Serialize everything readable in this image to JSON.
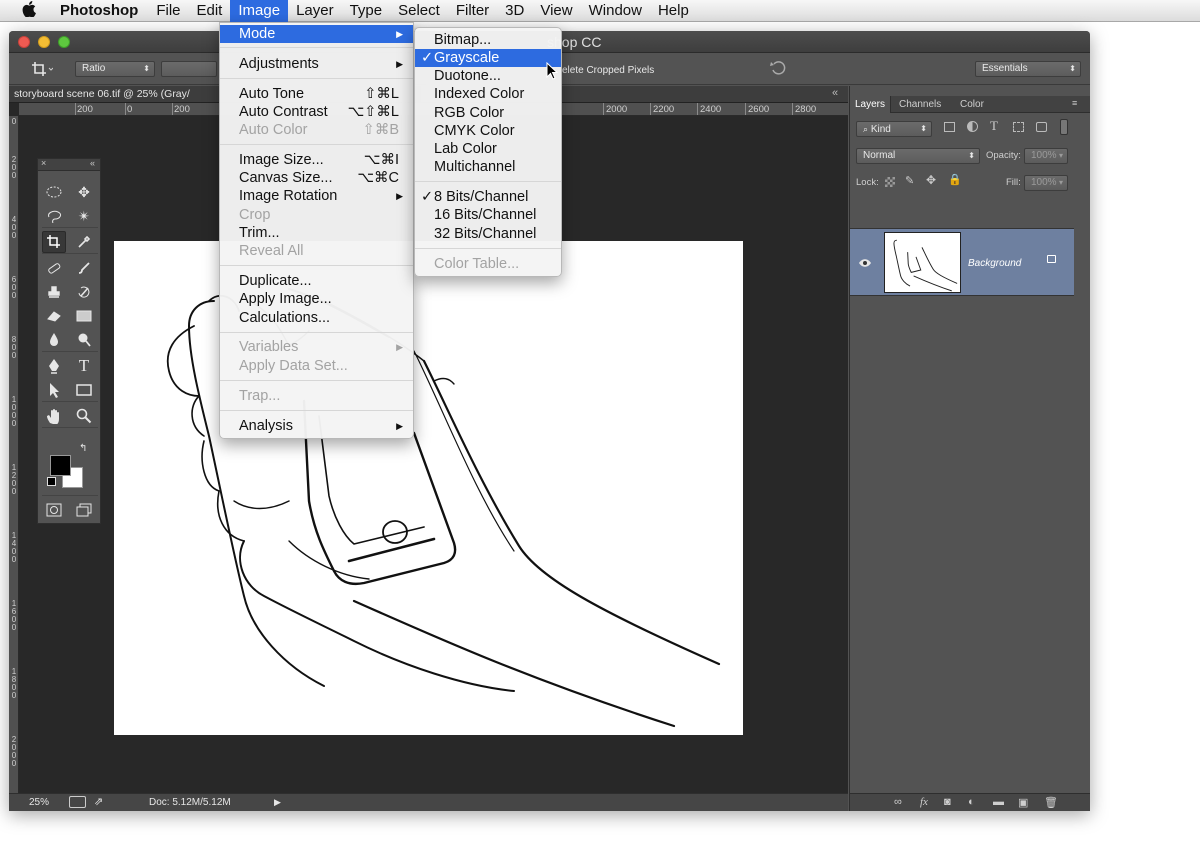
{
  "menubar": {
    "apple": "",
    "items": [
      "Photoshop",
      "File",
      "Edit",
      "Image",
      "Layer",
      "Type",
      "Select",
      "Filter",
      "3D",
      "View",
      "Window",
      "Help"
    ],
    "active": "Image"
  },
  "window": {
    "title": "shop CC",
    "doc_tab": "storyboard scene 06.tif @ 25% (Gray/",
    "doc_tab_close": "«"
  },
  "options_bar": {
    "ratio": "Ratio",
    "delete_cropped": "elete Cropped Pixels",
    "workspace": "Essentials"
  },
  "ruler_top": [
    "200",
    "0",
    "200",
    "2000",
    "2200",
    "2400",
    "2600",
    "2800"
  ],
  "ruler_left": [
    "0",
    "2 0 0",
    "4 0 0",
    "6 0 0",
    "8 0 0",
    "1 0 0 0",
    "1 2 0 0",
    "1 4 0 0",
    "1 6 0 0",
    "1 8 0 0",
    "2 0 0 0"
  ],
  "image_menu": {
    "items": [
      {
        "label": "Mode",
        "sub": true,
        "highlight": true
      },
      {
        "label": "Adjustments",
        "sub": true
      },
      {
        "label": "Auto Tone",
        "shortcut": "⇧⌘L"
      },
      {
        "label": "Auto Contrast",
        "shortcut": "⌥⇧⌘L"
      },
      {
        "label": "Auto Color",
        "shortcut": "⇧⌘B",
        "disabled": true
      },
      {
        "label": "Image Size...",
        "shortcut": "⌥⌘I"
      },
      {
        "label": "Canvas Size...",
        "shortcut": "⌥⌘C"
      },
      {
        "label": "Image Rotation",
        "sub": true
      },
      {
        "label": "Crop",
        "disabled": true
      },
      {
        "label": "Trim..."
      },
      {
        "label": "Reveal All",
        "disabled": true
      },
      {
        "label": "Duplicate..."
      },
      {
        "label": "Apply Image..."
      },
      {
        "label": "Calculations..."
      },
      {
        "label": "Variables",
        "sub": true,
        "disabled": true
      },
      {
        "label": "Apply Data Set...",
        "disabled": true
      },
      {
        "label": "Trap...",
        "disabled": true
      },
      {
        "label": "Analysis",
        "sub": true
      }
    ]
  },
  "mode_menu": {
    "items": [
      {
        "label": "Bitmap..."
      },
      {
        "label": "Grayscale",
        "checked": true,
        "highlight": true
      },
      {
        "label": "Duotone..."
      },
      {
        "label": "Indexed Color"
      },
      {
        "label": "RGB Color"
      },
      {
        "label": "CMYK Color"
      },
      {
        "label": "Lab Color"
      },
      {
        "label": "Multichannel"
      },
      {
        "label": "8 Bits/Channel",
        "checked": true
      },
      {
        "label": "16 Bits/Channel"
      },
      {
        "label": "32 Bits/Channel"
      },
      {
        "label": "Color Table...",
        "disabled": true
      }
    ]
  },
  "layers_panel": {
    "tabs": [
      "Layers",
      "Channels",
      "Color"
    ],
    "kind": "Kind",
    "blend_mode": "Normal",
    "opacity_label": "Opacity:",
    "opacity_value": "100%",
    "lock_label": "Lock:",
    "fill_label": "Fill:",
    "fill_value": "100%",
    "layer_name": "Background"
  },
  "status": {
    "zoom": "25%",
    "doc": "Doc: 5.12M/5.12M"
  },
  "colors": {
    "highlight": "#2d6be0",
    "layer_selected": "#6e80a0",
    "panel_bg": "#535353"
  }
}
